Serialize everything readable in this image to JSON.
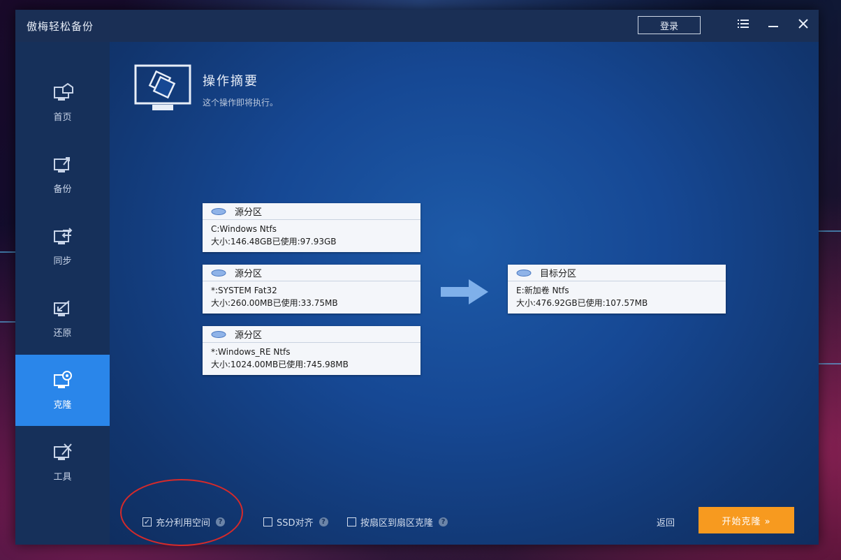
{
  "window": {
    "title": "傲梅轻松备份",
    "login_label": "登录",
    "menu_icon": "menu-icon",
    "minimize_icon": "minimize-icon",
    "close_icon": "close-icon"
  },
  "sidebar": {
    "items": [
      {
        "label": "首页",
        "icon": "home-icon"
      },
      {
        "label": "备份",
        "icon": "backup-icon"
      },
      {
        "label": "同步",
        "icon": "sync-icon"
      },
      {
        "label": "还原",
        "icon": "restore-icon"
      },
      {
        "label": "克隆",
        "icon": "clone-icon",
        "active": true
      },
      {
        "label": "工具",
        "icon": "tools-icon"
      }
    ]
  },
  "summary": {
    "title": "操作摘要",
    "subtitle": "这个操作即将执行。"
  },
  "source_partitions": [
    {
      "header": "源分区",
      "name": "C:Windows Ntfs",
      "size": "大小:146.48GB已使用:97.93GB"
    },
    {
      "header": "源分区",
      "name": "*:SYSTEM Fat32",
      "size": "大小:260.00MB已使用:33.75MB"
    },
    {
      "header": "源分区",
      "name": "*:Windows_RE Ntfs",
      "size": "大小:1024.00MB已使用:745.98MB"
    }
  ],
  "target_partition": {
    "header": "目标分区",
    "name": "E:新加卷 Ntfs",
    "size": "大小:476.92GB已使用:107.57MB"
  },
  "options": [
    {
      "label": "充分利用空间",
      "checked": true
    },
    {
      "label": "SSD对齐",
      "checked": false
    },
    {
      "label": "按扇区到扇区克隆",
      "checked": false
    }
  ],
  "footer": {
    "back_label": "返回",
    "start_label": "开始克隆 »"
  },
  "colors": {
    "accent": "#2a86ea",
    "start_button": "#f79a1f",
    "annotation": "#d62a2a"
  }
}
